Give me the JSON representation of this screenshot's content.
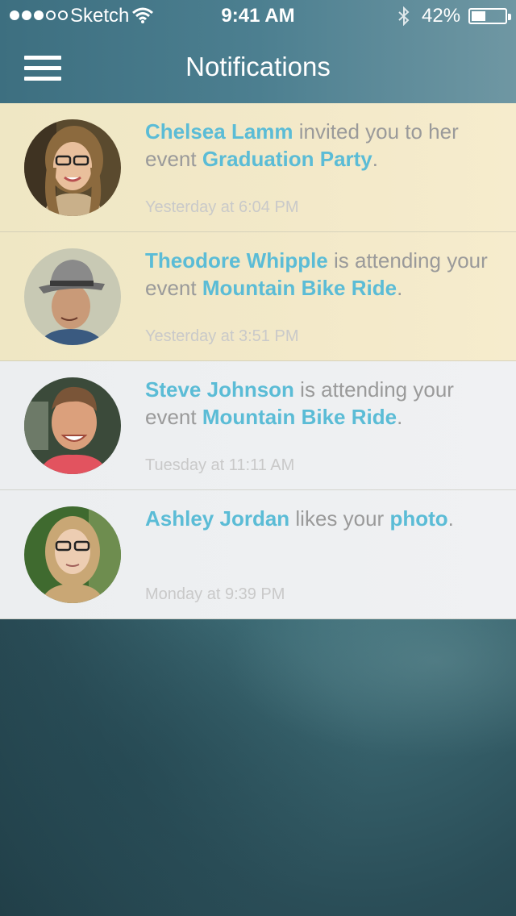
{
  "status_bar": {
    "carrier": "Sketch",
    "time": "9:41 AM",
    "battery": "42%",
    "battery_level": 0.42,
    "signal_bars_filled": 3,
    "signal_bars_total": 5
  },
  "nav": {
    "title": "Notifications",
    "menu_icon": "hamburger-menu-icon"
  },
  "colors": {
    "accent": "#5bbcd6",
    "unread_bg": "#f1e8c6",
    "read_bg": "#eceef0"
  },
  "notifications": [
    {
      "name": "Chelsea Lamm",
      "text1": " invited you to her event ",
      "target": "Graduation Party",
      "end": ".",
      "time": "Yesterday at 6:04 PM",
      "unread": true
    },
    {
      "name": "Theodore Whipple",
      "text1": " is attending your event ",
      "target": "Mountain Bike Ride",
      "end": ".",
      "time": "Yesterday at 3:51 PM",
      "unread": true
    },
    {
      "name": "Steve Johnson",
      "text1": " is attending your event ",
      "target": "Mountain Bike Ride",
      "end": ".",
      "time": "Tuesday at 11:11 AM",
      "unread": false
    },
    {
      "name": "Ashley Jordan",
      "text1": " likes your ",
      "target": "photo",
      "end": ".",
      "time": "Monday at 9:39 PM",
      "unread": false
    }
  ]
}
